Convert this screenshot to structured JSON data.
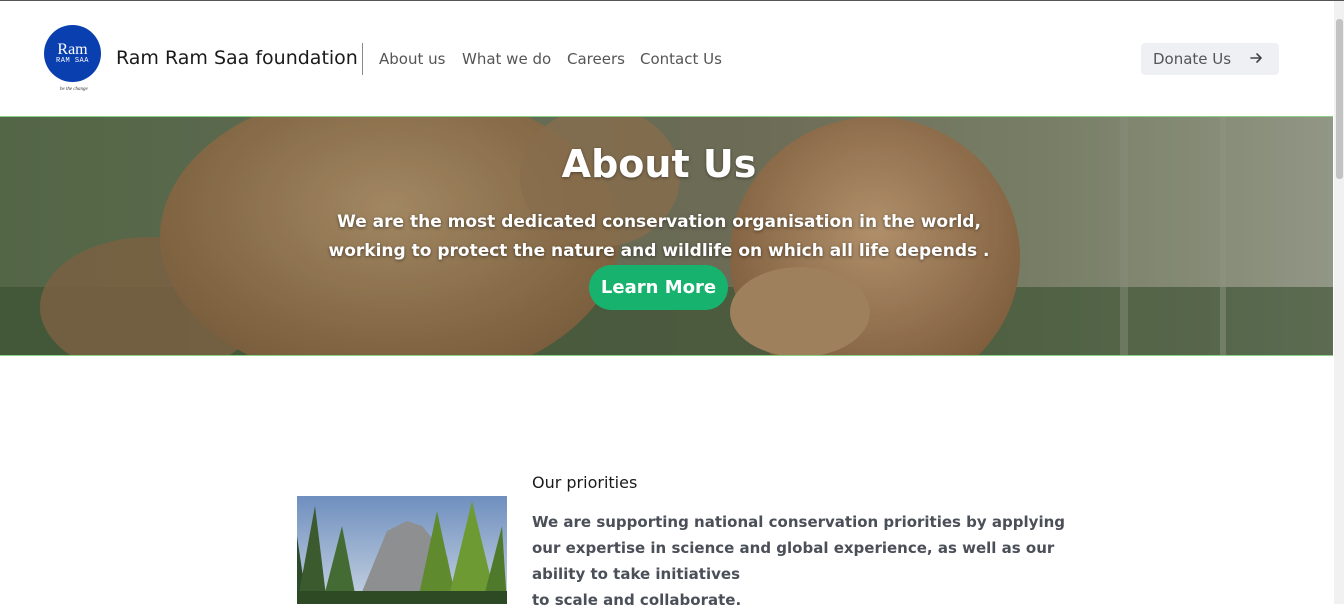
{
  "header": {
    "logo": {
      "text_big": "Ram",
      "text_small": "RAM SAA",
      "tagline": "be the change"
    },
    "brand": "Ram Ram Saa foundation",
    "nav": [
      "About us",
      "What we do",
      "Careers",
      "Contact Us"
    ],
    "donate_label": "Donate Us",
    "donate_icon": "arrow-right-icon"
  },
  "hero": {
    "title": "About Us",
    "lines": [
      "We are the most dedicated conservation organisation in the world,",
      "working to protect the nature and wildlife on which all life depends ."
    ],
    "button_label": "Learn More",
    "button_color": "#17b36e"
  },
  "priorities": {
    "title": "Our priorities",
    "lines": [
      "We are supporting national conservation priorities by applying",
      "our expertise in science and global experience, as well as our",
      "ability to take initiatives",
      "to scale and collaborate."
    ]
  },
  "colors": {
    "brand_blue": "#0a3fb0",
    "accent_green": "#17b36e"
  }
}
